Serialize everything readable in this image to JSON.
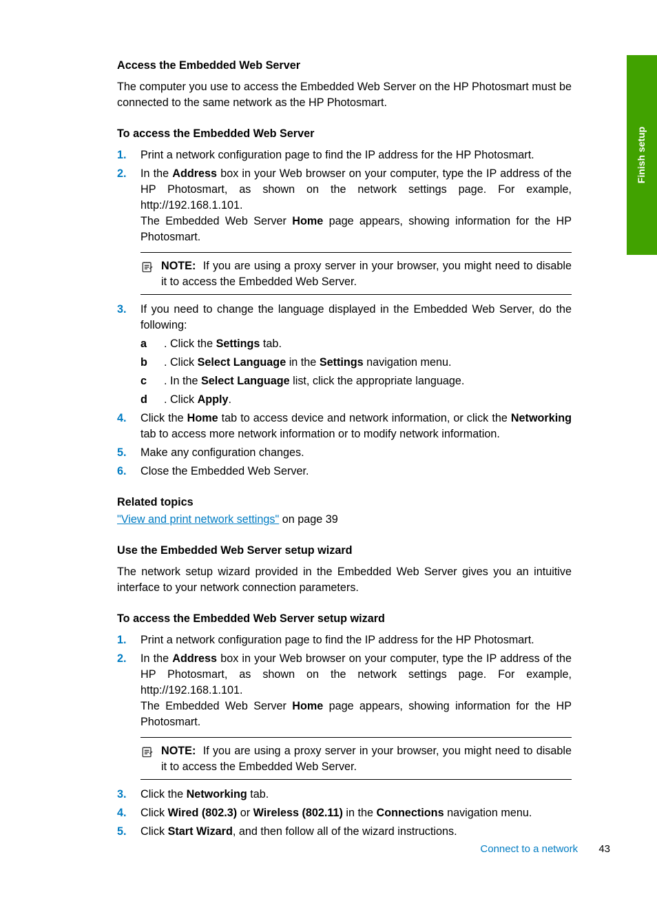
{
  "side_tab": "Finish setup",
  "section1": {
    "heading": "Access the Embedded Web Server",
    "intro": "The computer you use to access the Embedded Web Server on the HP Photosmart must be connected to the same network as the HP Photosmart."
  },
  "procedure1": {
    "heading": "To access the Embedded Web Server",
    "steps": {
      "s1_num": "1.",
      "s1": "Print a network configuration page to find the IP address for the HP Photosmart.",
      "s2_num": "2.",
      "s2_a": "In the ",
      "s2_bold": "Address",
      "s2_b": " box in your Web browser on your computer, type the IP address of the HP Photosmart, as shown on the network settings page. For example, http://192.168.1.101.",
      "s2_c": "The Embedded Web Server ",
      "s2_home": "Home",
      "s2_d": " page appears, showing information for the HP Photosmart.",
      "note_label": "NOTE:",
      "note_text": "If you are using a proxy server in your browser, you might need to disable it to access the Embedded Web Server.",
      "s3_num": "3.",
      "s3": "If you need to change the language displayed in the Embedded Web Server, do the following:",
      "s3a_let": "a",
      "s3a_a": ".   Click the ",
      "s3a_b": "Settings",
      "s3a_c": " tab.",
      "s3b_let": "b",
      "s3b_a": ".   Click ",
      "s3b_b": "Select Language",
      "s3b_c": " in the ",
      "s3b_d": "Settings",
      "s3b_e": " navigation menu.",
      "s3c_let": "c",
      "s3c_a": ".   In the ",
      "s3c_b": "Select Language",
      "s3c_c": " list, click the appropriate language.",
      "s3d_let": "d",
      "s3d_a": ".   Click ",
      "s3d_b": "Apply",
      "s3d_c": ".",
      "s4_num": "4.",
      "s4_a": "Click the ",
      "s4_b": "Home",
      "s4_c": " tab to access device and network information, or click the ",
      "s4_d": "Networking",
      "s4_e": " tab to access more network information or to modify network information.",
      "s5_num": "5.",
      "s5": "Make any configuration changes.",
      "s6_num": "6.",
      "s6": "Close the Embedded Web Server."
    }
  },
  "related": {
    "heading": "Related topics",
    "link_text": "\"View and print network settings\"",
    "link_rest": " on page 39"
  },
  "section2": {
    "heading": "Use the Embedded Web Server setup wizard",
    "intro": "The network setup wizard provided in the Embedded Web Server gives you an intuitive interface to your network connection parameters."
  },
  "procedure2": {
    "heading": "To access the Embedded Web Server setup wizard",
    "steps": {
      "s1_num": "1.",
      "s1": "Print a network configuration page to find the IP address for the HP Photosmart.",
      "s2_num": "2.",
      "s2_a": "In the ",
      "s2_bold": "Address",
      "s2_b": " box in your Web browser on your computer, type the IP address of the HP Photosmart, as shown on the network settings page. For example, http://192.168.1.101.",
      "s2_c": "The Embedded Web Server ",
      "s2_home": "Home",
      "s2_d": " page appears, showing information for the HP Photosmart.",
      "note_label": "NOTE:",
      "note_text": "If you are using a proxy server in your browser, you might need to disable it to access the Embedded Web Server.",
      "s3_num": "3.",
      "s3_a": "Click the ",
      "s3_b": "Networking",
      "s3_c": " tab.",
      "s4_num": "4.",
      "s4_a": "Click ",
      "s4_b": "Wired (802.3)",
      "s4_c": " or ",
      "s4_d": "Wireless (802.11)",
      "s4_e": " in the ",
      "s4_f": "Connections",
      "s4_g": " navigation menu.",
      "s5_num": "5.",
      "s5_a": "Click ",
      "s5_b": "Start Wizard",
      "s5_c": ", and then follow all of the wizard instructions."
    }
  },
  "footer": {
    "section": "Connect to a network",
    "page": "43"
  }
}
